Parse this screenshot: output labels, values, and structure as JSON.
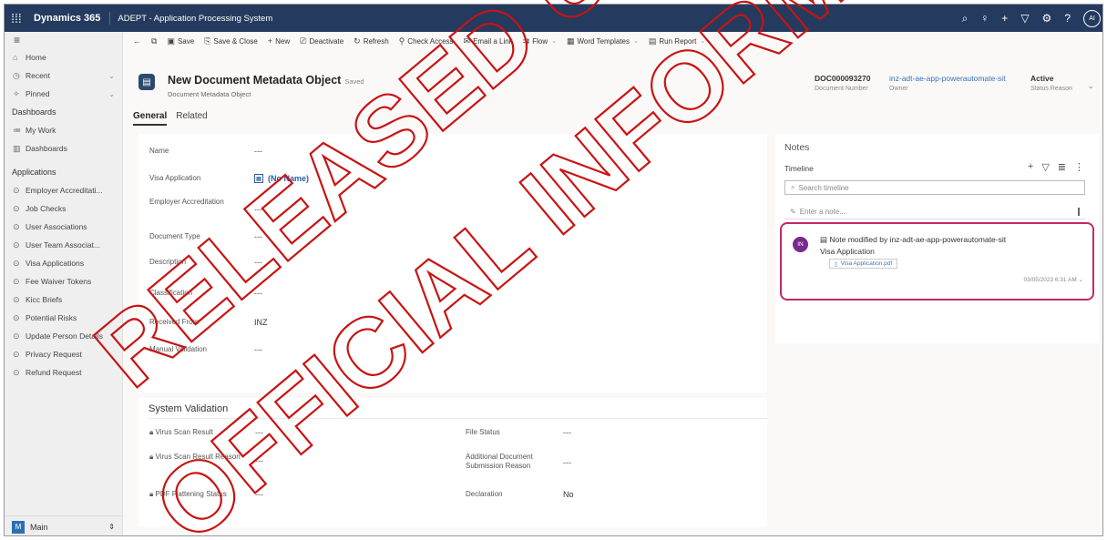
{
  "topbar": {
    "brand": "Dynamics 365",
    "app_title": "ADEPT - Application Processing System",
    "avatar_initials": "AI"
  },
  "sidebar": {
    "home": "Home",
    "recent": "Recent",
    "pinned": "Pinned",
    "dashboards_group": "Dashboards",
    "my_work": "My Work",
    "dashboards": "Dashboards",
    "applications_group": "Applications",
    "items": [
      "Employer Accreditati...",
      "Job Checks",
      "User Associations",
      "User Team Associat...",
      "Visa Applications",
      "Fee Waiver Tokens",
      "Kicc Briefs",
      "Potential Risks",
      "Update Person Details",
      "Privacy Request",
      "Refund Request"
    ],
    "area_initial": "M",
    "area_label": "Main"
  },
  "commandbar": {
    "save": "Save",
    "save_close": "Save & Close",
    "new": "New",
    "deactivate": "Deactivate",
    "refresh": "Refresh",
    "check_access": "Check Access",
    "email_link": "Email a Link",
    "flow": "Flow",
    "word_templates": "Word Templates",
    "run_report": "Run Report"
  },
  "record": {
    "title": "New Document Metadata Object",
    "saved_status": "Saved",
    "entity": "Document Metadata Object",
    "doc_number": "DOC000093270",
    "doc_number_label": "Document Number",
    "owner": "inz-adt-ae-app-powerautomate-sit",
    "owner_label": "Owner",
    "status": "Active",
    "status_label": "Status Reason"
  },
  "tabs": [
    "General",
    "Related"
  ],
  "form": {
    "name_label": "Name",
    "name_value": "---",
    "visa_label": "Visa Application",
    "visa_value": "(No Name)",
    "employer_label": "Employer Accreditation",
    "employer_value": "---",
    "doctype_label": "Document Type",
    "doctype_value": "---",
    "desc_label": "Description",
    "desc_value": "---",
    "class_label": "Classification",
    "class_value": "---",
    "received_label": "Received From",
    "received_value": "INZ",
    "manual_label": "Manual Validation",
    "manual_value": "---"
  },
  "system_validation": {
    "title": "System Validation",
    "virus_result_label": "Virus Scan Result",
    "virus_result_value": "---",
    "virus_reason_label": "Virus Scan Result Reason",
    "virus_reason_value": "---",
    "pdf_label": "PDF Flattening Status",
    "pdf_value": "---",
    "file_status_label": "File Status",
    "file_status_value": "---",
    "add_doc_label": "Additional Document Submission Reason",
    "add_doc_value": "---",
    "declaration_label": "Declaration",
    "declaration_value": "No"
  },
  "notes": {
    "title": "Notes",
    "timeline_title": "Timeline",
    "search_placeholder": "Search timeline",
    "note_placeholder": "Enter a note...",
    "entry": {
      "initials": "IN",
      "title": "Note modified by inz-adt-ae-app-powerautomate-sit",
      "subtitle": "Visa Application",
      "attachment": "Visa Application.pdf",
      "timestamp": "03/05/2023 6:31 AM"
    }
  },
  "watermark": {
    "line1": "RELEASED UNDER THE",
    "line2": "OFFICIAL INFORMATION ACT"
  }
}
